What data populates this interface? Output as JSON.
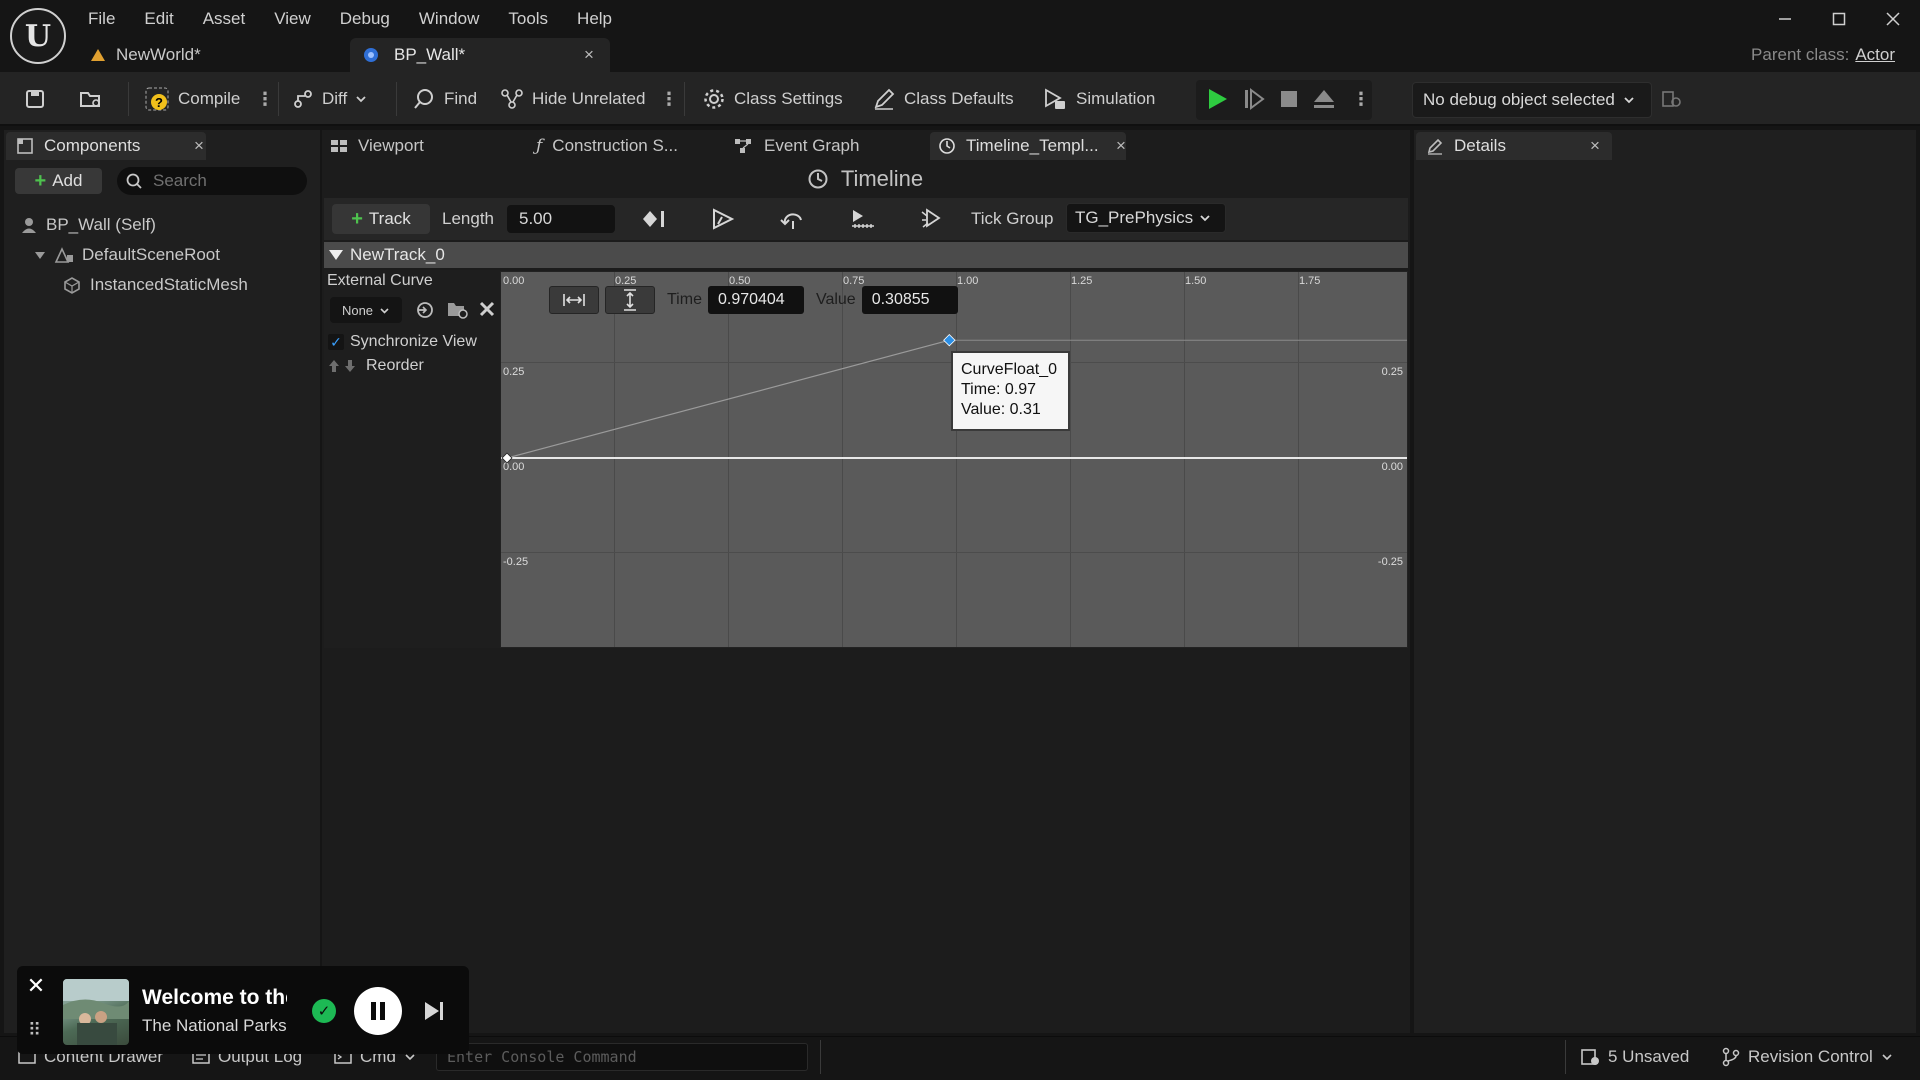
{
  "menu": [
    "File",
    "Edit",
    "Asset",
    "View",
    "Debug",
    "Window",
    "Tools",
    "Help"
  ],
  "doc_tabs": [
    {
      "label": "NewWorld*"
    },
    {
      "label": "BP_Wall*"
    }
  ],
  "parent_class": {
    "label": "Parent class:",
    "value": "Actor"
  },
  "toolbar": {
    "compile": "Compile",
    "diff": "Diff",
    "find": "Find",
    "hide_unrelated": "Hide Unrelated",
    "class_settings": "Class Settings",
    "class_defaults": "Class Defaults",
    "simulation": "Simulation",
    "debug_object": "No debug object selected"
  },
  "left_panel": {
    "tab": "Components",
    "add": "Add",
    "search_placeholder": "Search",
    "tree": [
      "BP_Wall (Self)",
      "DefaultSceneRoot",
      "InstancedStaticMesh"
    ]
  },
  "center_tabs": [
    "Viewport",
    "Construction S...",
    "Event Graph",
    "Timeline_Templ..."
  ],
  "right_panel": {
    "tab": "Details"
  },
  "timeline": {
    "title": "Timeline",
    "add_track": "Track",
    "length_label": "Length",
    "length_value": "5.00",
    "tick_group_label": "Tick Group",
    "tick_group_value": "TG_PrePhysics",
    "track_name": "NewTrack_0",
    "external_curve": "External Curve",
    "external_curve_value": "None",
    "sync_view": "Synchronize View",
    "reorder": "Reorder",
    "time_label": "Time",
    "time_value": "0.970404",
    "value_label": "Value",
    "value_value": "0.30855",
    "x_ticks": [
      "0.00",
      "0.25",
      "0.50",
      "0.75",
      "1.00",
      "1.25",
      "1.50",
      "1.75"
    ],
    "y_ticks": [
      "0.25",
      "0.00",
      "-0.25"
    ],
    "tooltip": {
      "name": "CurveFloat_0",
      "time": "Time: 0.97",
      "value": "Value: 0.31"
    },
    "keys": [
      {
        "time": 0.0,
        "value": 0.0
      },
      {
        "time": 0.97,
        "value": 0.31
      }
    ]
  },
  "statusbar": {
    "content_drawer": "Content Drawer",
    "output_log": "Output Log",
    "cmd": "Cmd",
    "console_placeholder": "Enter Console Command",
    "unsaved": "5 Unsaved",
    "revision_control": "Revision Control"
  },
  "media": {
    "title": "Welcome to the",
    "subtitle": "The National Parks"
  },
  "colors": {
    "play": "#2ecc40",
    "accent": "#3aa0ff",
    "spotify": "#1db954"
  }
}
